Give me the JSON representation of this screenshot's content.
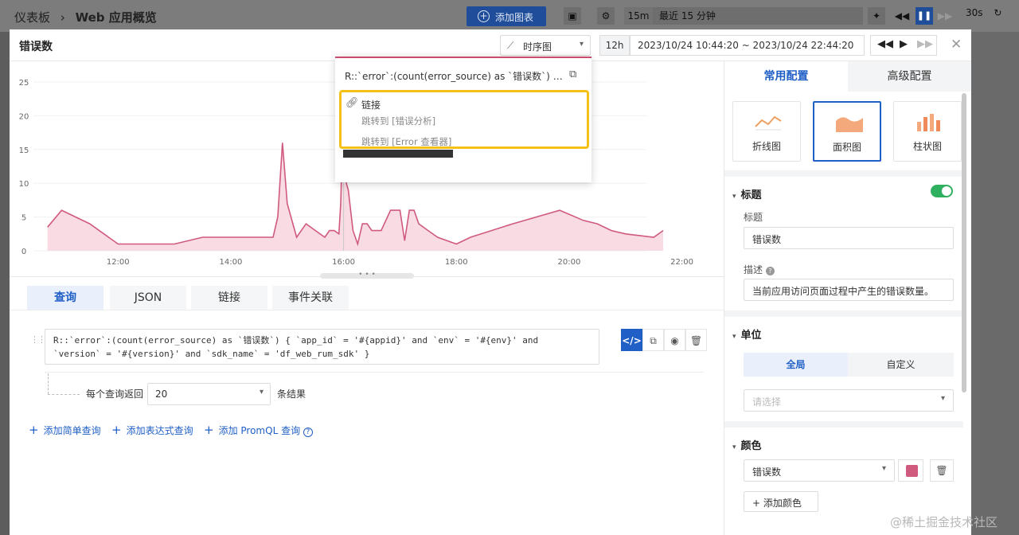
{
  "topbar": {
    "breadcrumb_root": "仪表板",
    "breadcrumb_sep": "›",
    "breadcrumb_current": "Web 应用概览",
    "add_chart": "添加图表",
    "quick_range": "15m",
    "range_label": "最近 15 分钟",
    "refresh_interval": "30s"
  },
  "modal": {
    "title": "错误数",
    "chart_type": "时序图",
    "time_quick": "12h",
    "time_range": "2023/10/24 10:44:20 ~ 2023/10/24 22:44:20"
  },
  "chart_data": {
    "type": "area",
    "x": [
      "10:45",
      "11:00",
      "11:30",
      "12:00",
      "12:30",
      "13:00",
      "13:30",
      "14:00",
      "14:30",
      "14:45",
      "14:50",
      "14:55",
      "15:00",
      "15:10",
      "15:20",
      "15:30",
      "15:40",
      "15:45",
      "15:50",
      "15:55",
      "15:57",
      "16:00",
      "16:03",
      "16:05",
      "16:10",
      "16:15",
      "16:20",
      "16:25",
      "16:30",
      "16:40",
      "16:50",
      "17:00",
      "17:05",
      "17:10",
      "17:15",
      "17:20",
      "17:30",
      "17:40",
      "18:00",
      "18:15",
      "19:00",
      "19:50",
      "20:15",
      "20:30",
      "20:45",
      "21:00",
      "21:30",
      "21:40"
    ],
    "values": [
      3.5,
      6,
      4,
      1,
      1,
      1,
      2,
      2,
      2,
      2,
      5,
      16,
      7,
      2,
      4,
      3,
      2,
      3,
      3,
      2.5,
      7,
      23,
      10,
      9,
      3,
      1,
      4,
      4,
      3,
      3,
      6,
      6,
      1.5,
      6,
      6,
      4,
      3,
      2,
      1,
      2,
      4,
      6,
      4.5,
      4,
      3,
      2.5,
      2,
      3
    ],
    "series_name": "错误数",
    "x_ticks": [
      "12:00",
      "14:00",
      "16:00",
      "18:00",
      "20:00",
      "22:00"
    ],
    "y_ticks": [
      0,
      5,
      10,
      15,
      20,
      25
    ],
    "ylim": [
      0,
      25
    ],
    "highlight_value": 23,
    "color": "#d05a7e",
    "fill": "#f8dbe3"
  },
  "popup": {
    "expr": "R::`error`:(count(error_source) as `错误数`) { `app_id` = '#{appid}' and `env` = '#{env}' and `version` = '#{version}' and `sdk_name` = 'df_web_rum_sdk' }",
    "links_title": "链接",
    "link1": "跳转到 [错误分析]",
    "link2": "跳转到 [Error 查看器]"
  },
  "tabs": {
    "query": "查询",
    "json": "JSON",
    "links": "链接",
    "events": "事件关联"
  },
  "query": {
    "text": "R::`error`:(count(error_source) as `错误数`) { `app_id` = '#{appid}' and `env` = '#{env}' and `version` = '#{version}' and `sdk_name` = 'df_web_rum_sdk' }",
    "return_label": "每个查询返回",
    "return_value": "20",
    "return_suffix": "条结果",
    "add_simple": "添加简单查询",
    "add_expr": "添加表达式查询",
    "add_promql": "添加 PromQL 查询"
  },
  "panel": {
    "tab_common": "常用配置",
    "tab_advanced": "高级配置",
    "vis_line": "折线图",
    "vis_area": "面积图",
    "vis_bar": "柱状图",
    "title_section": "标题",
    "title_label": "标题",
    "title_value": "错误数",
    "desc_label": "描述",
    "desc_value": "当前应用访问页面过程中产生的错误数量。",
    "unit_section": "单位",
    "unit_global": "全局",
    "unit_custom": "自定义",
    "unit_placeholder": "请选择",
    "color_section": "颜色",
    "color_series": "错误数",
    "add_color": "添加颜色"
  },
  "watermark": "@稀土掘金技术社区"
}
